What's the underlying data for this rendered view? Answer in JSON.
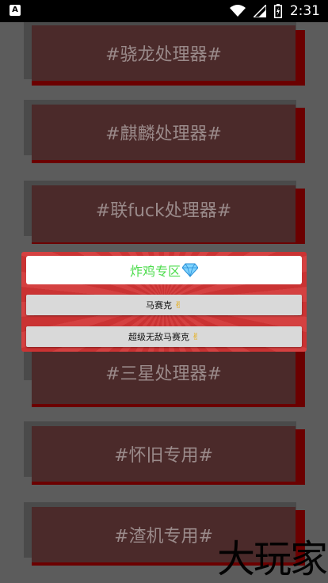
{
  "status_bar": {
    "time": "2:31",
    "left_icon": "A",
    "icons": [
      "wifi-icon",
      "signal-icon",
      "battery-icon"
    ]
  },
  "background_list": [
    {
      "label": "#骁龙处理器#"
    },
    {
      "label": "#麒麟处理器#"
    },
    {
      "label": "#联fuck处理器#"
    },
    {
      "label": ""
    },
    {
      "label": "#三星处理器#"
    },
    {
      "label": "#怀旧专用#"
    },
    {
      "label": "#渣机专用#"
    }
  ],
  "dialog": {
    "title": "炸鸡专区",
    "title_icon": "diamond-icon",
    "buttons": [
      {
        "label": "马赛克",
        "icon": "hand-horns-icon"
      },
      {
        "label": "超级无敌马赛克",
        "icon": "hand-horns-icon"
      }
    ]
  },
  "watermark": "大玩家",
  "colors": {
    "dialog_bg": "#d23535",
    "title_text": "#4ddc4d",
    "item_face": "#4b2a2a",
    "item_shadow": "#6b0000"
  }
}
